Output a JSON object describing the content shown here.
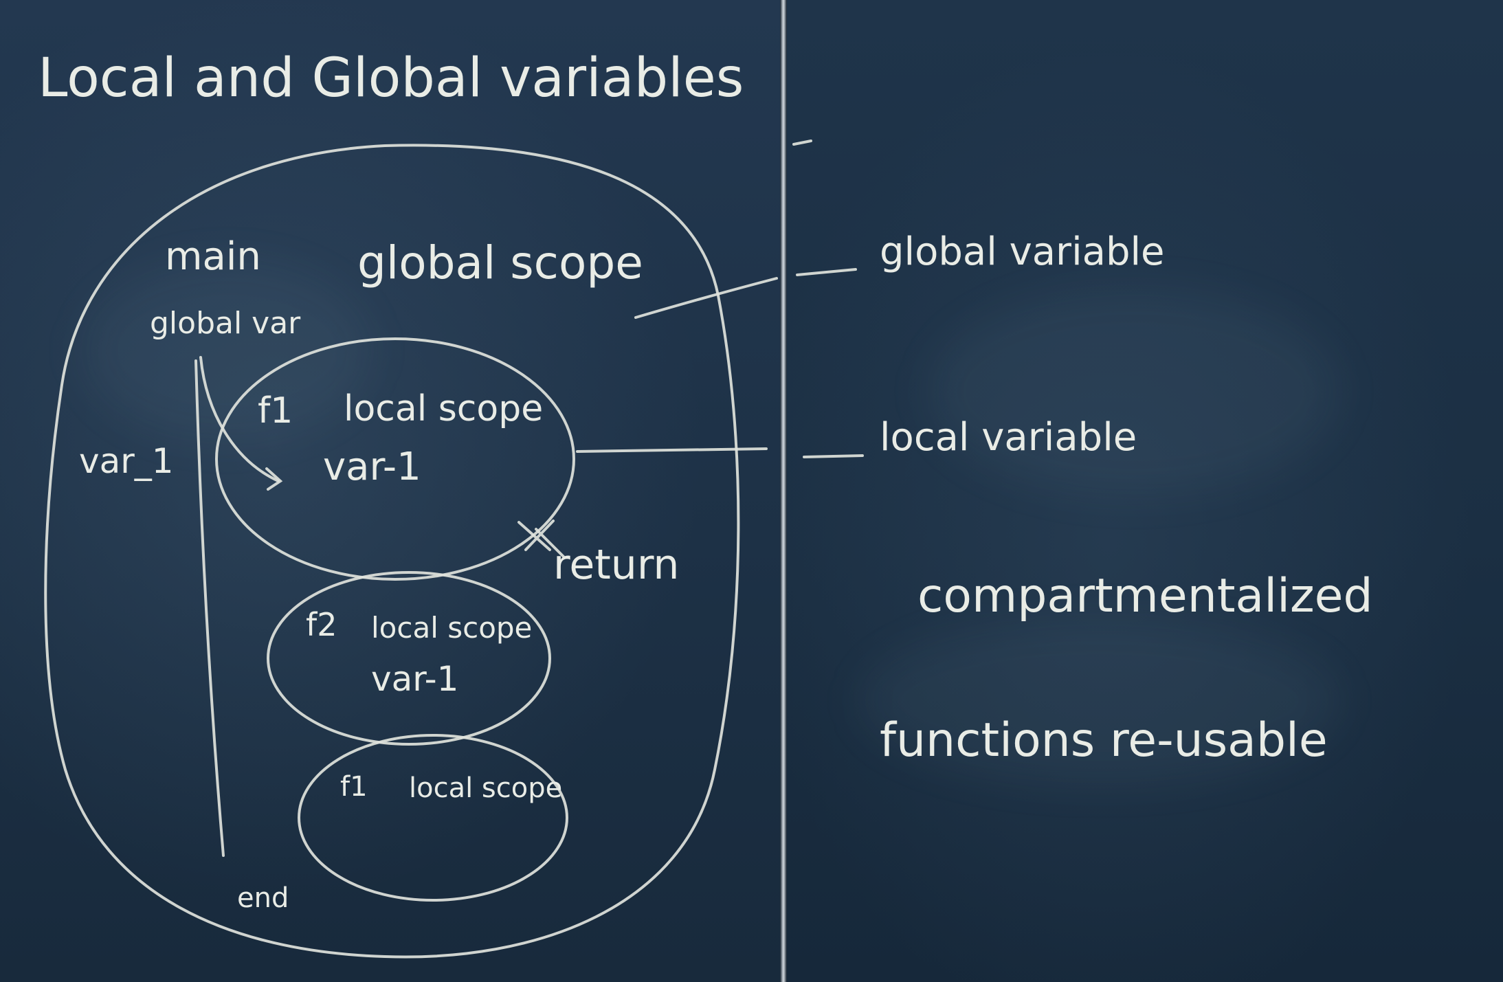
{
  "title": "Local and Global variables",
  "diagram": {
    "main_label": "main",
    "global_scope_label": "global scope",
    "global_var_label": "global var",
    "left_var_label": "var_1",
    "f1": {
      "name": "f1",
      "scope": "local scope",
      "var": "var-1"
    },
    "return_label": "return",
    "f2": {
      "name": "f2",
      "scope": "local scope",
      "var": "var-1"
    },
    "f1_again": {
      "name": "f1",
      "scope": "local scope"
    },
    "end_label": "end"
  },
  "notes": {
    "global_variable": "global variable",
    "local_variable": "local variable",
    "compartmentalized": "compartmentalized",
    "functions_reusable": "functions re-usable"
  },
  "colors": {
    "board": "#1d3146",
    "chalk": "#e9ece6"
  }
}
